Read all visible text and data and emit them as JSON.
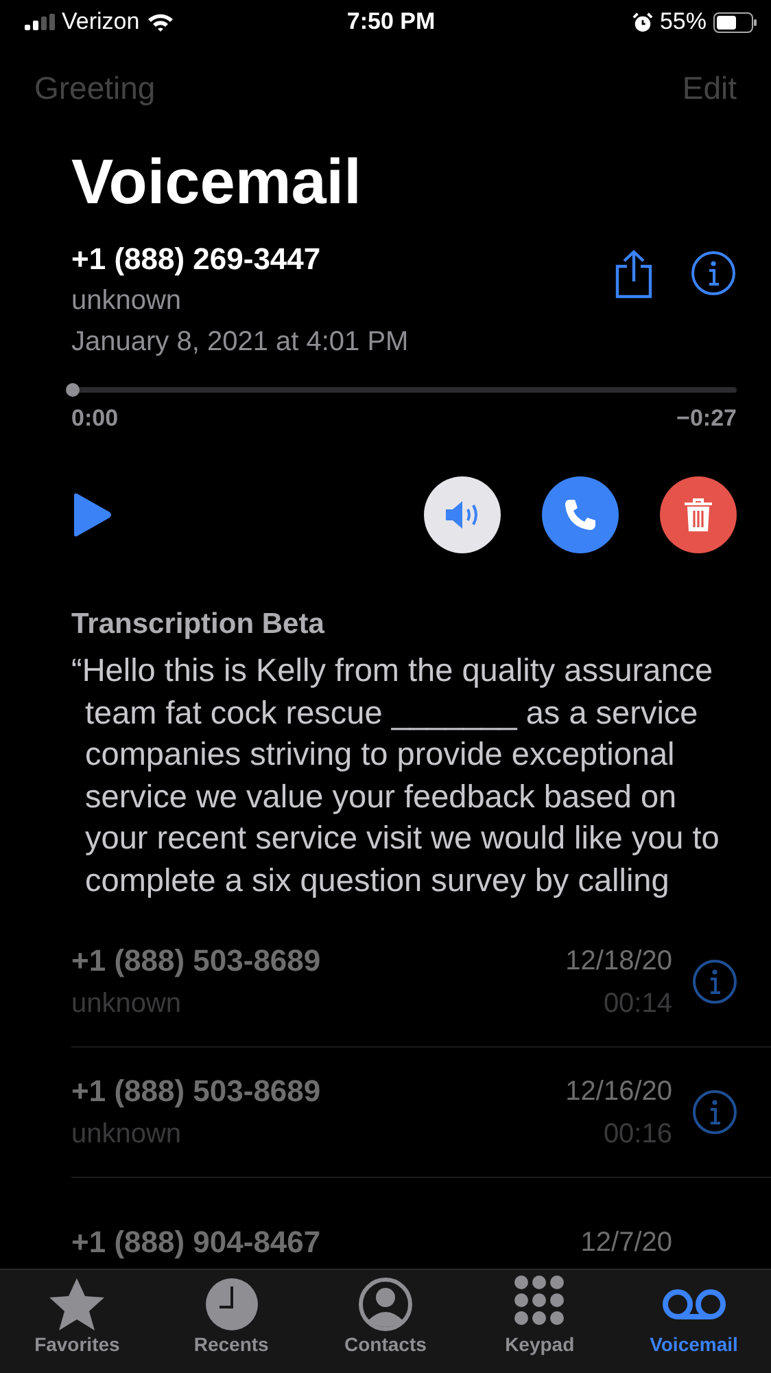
{
  "status_bar": {
    "carrier": "Verizon",
    "time": "7:50 PM",
    "battery": "55%"
  },
  "nav": {
    "left": "Greeting",
    "right": "Edit"
  },
  "title": "Voicemail",
  "message": {
    "number": "+1 (888) 269-3447",
    "label": "unknown",
    "date": "January 8, 2021 at 4:01 PM",
    "level": 0,
    "elapsed": "0:00",
    "remaining": "−0:27",
    "speaker_on": false
  },
  "transcription": {
    "heading": "Transcription Beta",
    "text": "“Hello this is Kelly from the quality assurance team fat cock rescue _______ as a service companies striving to provide exceptional service we value your feedback based on your recent service visit we would like you to complete a six question survey by calling"
  },
  "voicemails": [
    {
      "number": "+1 (888) 503-8689",
      "label": "unknown",
      "date": "12/18/20",
      "duration": "00:14"
    },
    {
      "number": "+1 (888) 503-8689",
      "label": "unknown",
      "date": "12/16/20",
      "duration": "00:16"
    },
    {
      "number": "+1 (888) 904-8467",
      "date": "12/7/20"
    }
  ],
  "tabs": [
    {
      "label": "Favorites",
      "kind": "star",
      "selected": false
    },
    {
      "label": "Recents",
      "kind": "clock",
      "selected": false
    },
    {
      "label": "Contacts",
      "kind": "person",
      "selected": false
    },
    {
      "label": "Keypad",
      "kind": "keypad",
      "selected": false
    },
    {
      "label": "Voicemail",
      "kind": "voicemail",
      "selected": true
    }
  ]
}
